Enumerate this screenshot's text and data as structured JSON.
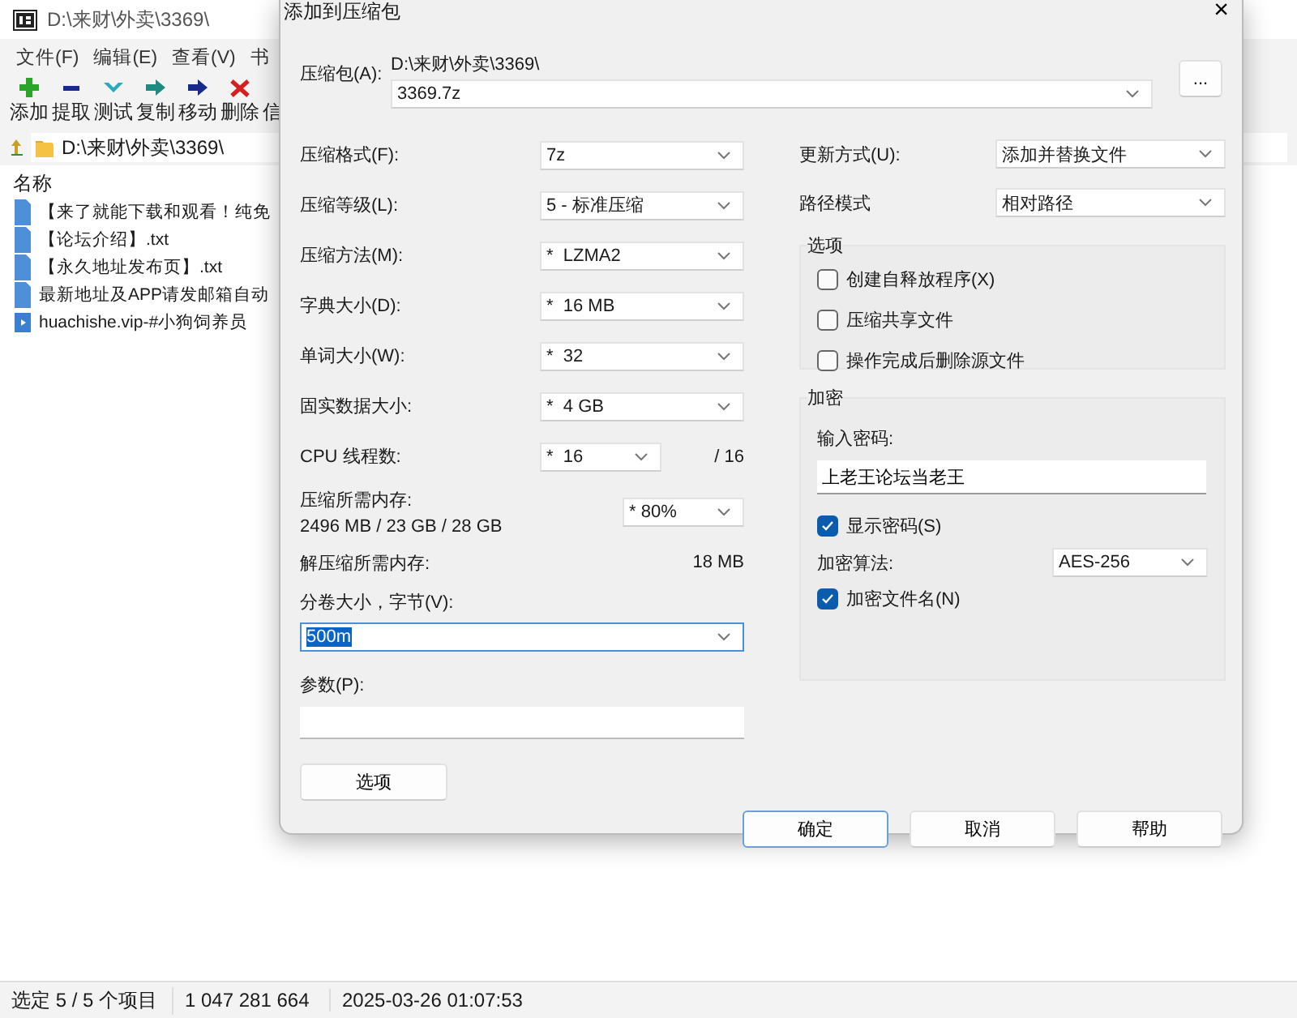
{
  "main_window": {
    "title": "D:\\来财\\外卖\\3369\\",
    "menu": [
      "文件(F)",
      "编辑(E)",
      "查看(V)",
      "书"
    ],
    "toolbar": [
      "添加",
      "提取",
      "测试",
      "复制",
      "移动",
      "删除",
      "信"
    ],
    "address": "D:\\来财\\外卖\\3369\\",
    "list_header": "名称",
    "files": [
      {
        "name": "【来了就能下载和观看！纯免",
        "kind": "text"
      },
      {
        "name": "【论坛介绍】.txt",
        "kind": "text"
      },
      {
        "name": "【永久地址发布页】.txt",
        "kind": "text"
      },
      {
        "name": "最新地址及APP请发邮箱自动",
        "kind": "text"
      },
      {
        "name": "huachishe.vip-#小狗饲养员",
        "kind": "media"
      }
    ],
    "status_bar": {
      "selection": "选定 5 / 5 个项目",
      "size": "1 047 281 664",
      "modified": "2025-03-26 01:07:53"
    }
  },
  "dialog": {
    "title": "添加到压缩包",
    "close": "×",
    "archive": {
      "label": "压缩包(A):",
      "path": "D:\\来财\\外卖\\3369\\",
      "value": "3369.7z"
    },
    "browse_button": "...",
    "settings": [
      {
        "label": "压缩格式(F):",
        "value": "7z"
      },
      {
        "label": "压缩等级(L):",
        "value": "5 - 标准压缩"
      },
      {
        "label": "压缩方法(M):",
        "value": "*  LZMA2"
      },
      {
        "label": "字典大小(D):",
        "value": "*  16 MB"
      },
      {
        "label": "单词大小(W):",
        "value": "*  32"
      },
      {
        "label": "固实数据大小:",
        "value": "*  4 GB"
      }
    ],
    "cpu": {
      "label": "CPU 线程数:",
      "value": "*  16",
      "max": "/ 16"
    },
    "memory": {
      "label": "压缩所需内存:",
      "usage": "2496 MB / 23 GB / 28 GB",
      "value": "* 80%"
    },
    "decompress_memory": {
      "label": "解压缩所需内存:",
      "value": "18 MB"
    },
    "volume": {
      "label": "分卷大小，字节(V):",
      "value": "500m",
      "highlighted": true
    },
    "parameters": {
      "label": "参数(P):"
    },
    "options_button": "选项",
    "right_settings": [
      {
        "label": "更新方式(U):",
        "value": "添加并替换文件"
      },
      {
        "label": "路径模式",
        "value": "相对路径"
      }
    ],
    "options_group": {
      "title": "选项",
      "checkboxes": [
        {
          "label": "创建自释放程序(X)",
          "checked": false
        },
        {
          "label": "压缩共享文件",
          "checked": false
        },
        {
          "label": "操作完成后删除源文件",
          "checked": false
        }
      ]
    },
    "encryption": {
      "title": "加密",
      "password_label": "输入密码:",
      "password": "上老王论坛当老王",
      "show_password": {
        "label": "显示密码(S)",
        "checked": true
      },
      "method_label": "加密算法:",
      "method": "AES-256",
      "encrypt_names": {
        "label": "加密文件名(N)",
        "checked": true
      }
    },
    "buttons": [
      {
        "label": "确定",
        "focused": true
      },
      {
        "label": "取消",
        "focused": false
      },
      {
        "label": "帮助",
        "focused": false
      }
    ]
  }
}
